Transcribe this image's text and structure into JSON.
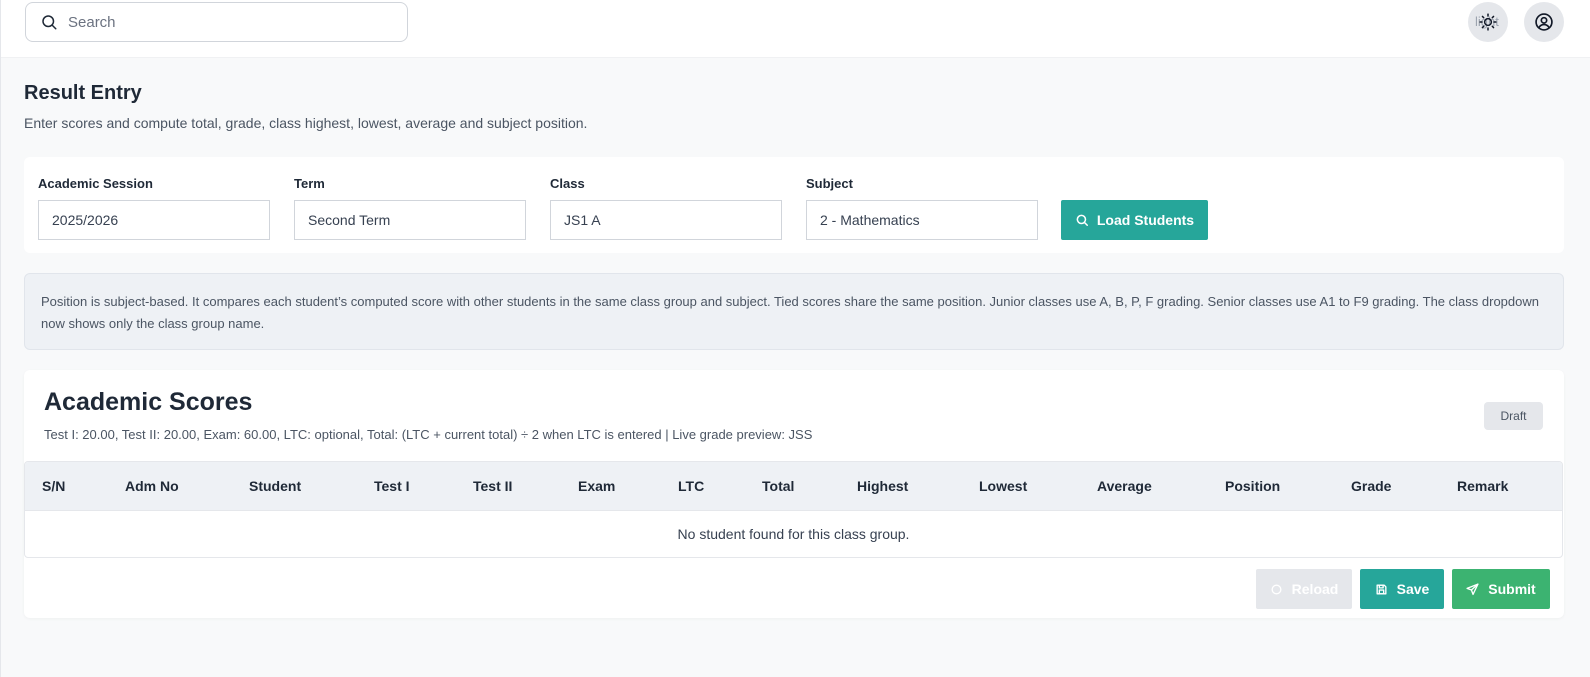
{
  "topbar": {
    "search_placeholder": "Search",
    "theme_label": "light",
    "icons": {
      "search": "search-icon",
      "theme": "sun-icon",
      "user": "user-circle-icon"
    }
  },
  "page": {
    "title": "Result Entry",
    "subtitle": "Enter scores and compute total, grade, class highest, lowest, average and subject position."
  },
  "filters": {
    "session": {
      "label": "Academic Session",
      "value": "2025/2026"
    },
    "term": {
      "label": "Term",
      "value": "Second Term"
    },
    "class": {
      "label": "Class",
      "value": "JS1 A"
    },
    "subject": {
      "label": "Subject",
      "value": "2 - Mathematics"
    },
    "load_label": "Load Students"
  },
  "notice": {
    "text": "Position is subject-based. It compares each student’s computed score with other students in the same class group and subject. Tied scores share the same position. Junior classes use A, B, P, F grading. Senior classes use A1 to F9 grading. The class dropdown now shows only the class group name."
  },
  "scores": {
    "title": "Academic Scores",
    "subtitle": "Test I: 20.00, Test II: 20.00, Exam: 60.00, LTC: optional, Total: (LTC + current total) ÷ 2 when LTC is entered | Live grade preview: JSS",
    "badge": "Draft",
    "columns": [
      "S/N",
      "Adm No",
      "Student",
      "Test I",
      "Test II",
      "Exam",
      "LTC",
      "Total",
      "Highest",
      "Lowest",
      "Average",
      "Position",
      "Grade",
      "Remark"
    ],
    "empty_message": "No student found for this class group.",
    "reload_label": "Reload",
    "save_label": "Save",
    "submit_label": "Submit"
  },
  "colors": {
    "primary": "#26a69a",
    "success": "#3cb371",
    "notice_bg": "#eef1f5",
    "disabled": "#e5e7eb"
  }
}
